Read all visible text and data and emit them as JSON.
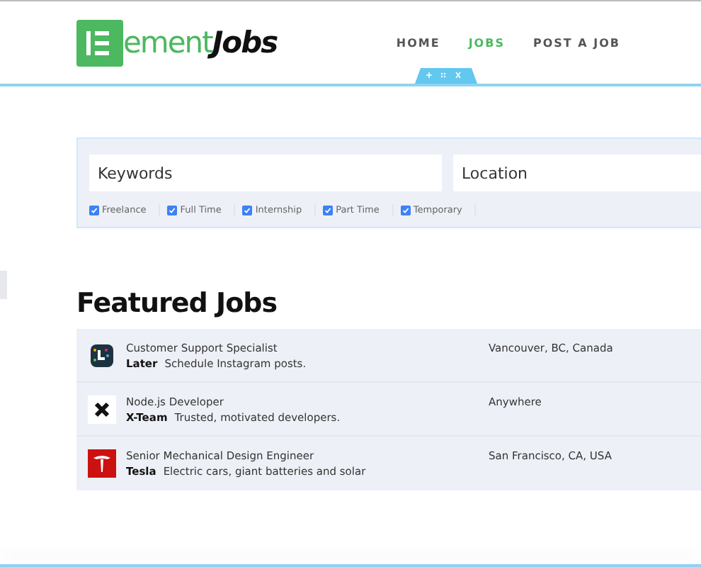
{
  "logo": {
    "text": "ement",
    "accent": "Jobs"
  },
  "nav": [
    {
      "label": "HOME",
      "selected": false
    },
    {
      "label": "JOBS",
      "selected": true
    },
    {
      "label": "POST A JOB",
      "selected": false
    }
  ],
  "search": {
    "keywords": {
      "placeholder": "Keywords"
    },
    "location": {
      "placeholder": "Location"
    },
    "job_types": [
      {
        "label": "Freelance",
        "checked": true
      },
      {
        "label": "Full Time",
        "checked": true
      },
      {
        "label": "Internship",
        "checked": true
      },
      {
        "label": "Part Time",
        "checked": true
      },
      {
        "label": "Temporary",
        "checked": true
      }
    ]
  },
  "featured": {
    "title": "Featured Jobs",
    "jobs": [
      {
        "title": "Customer Support Specialist",
        "company": "Later",
        "tagline": "Schedule Instagram posts.",
        "location": "Vancouver, BC, Canada",
        "kind": "later"
      },
      {
        "title": "Node.js Developer",
        "company": "X-Team",
        "tagline": "Trusted, motivated developers.",
        "location": "Anywhere",
        "kind": "xteam"
      },
      {
        "title": "Senior Mechanical Design Engineer",
        "company": "Tesla",
        "tagline": "Electric cars, giant batteries and solar",
        "location": "San Francisco, CA, USA",
        "kind": "tesla"
      }
    ]
  }
}
